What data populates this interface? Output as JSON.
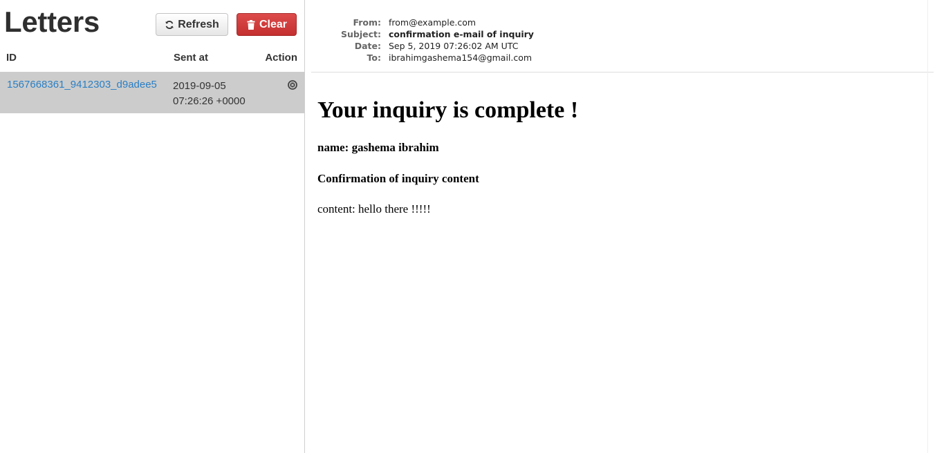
{
  "app": {
    "title": "Letters"
  },
  "toolbar": {
    "refresh_label": "Refresh",
    "clear_label": "Clear"
  },
  "table": {
    "headers": {
      "id": "ID",
      "sent_at": "Sent at",
      "action": "Action"
    },
    "rows": [
      {
        "id": "1567668361_9412303_d9adee5",
        "sent_date": "2019-09-05",
        "sent_time": "07:26:26 +0000",
        "action_icon": "remove-circle-icon"
      }
    ]
  },
  "message": {
    "headers": {
      "from_label": "From:",
      "from": "from@example.com",
      "subject_label": "Subject:",
      "subject": "confirmation e-mail of inquiry",
      "date_label": "Date:",
      "date": "Sep 5, 2019 07:26:02 AM UTC",
      "to_label": "To:",
      "to": "ibrahimgashema154@gmail.com"
    },
    "body": {
      "heading": "Your inquiry is complete !",
      "name_line": "name: gashema ibrahim",
      "section_title": "Confirmation of inquiry content",
      "content_line": "content: hello there !!!!!"
    }
  },
  "colors": {
    "link": "#2a7fc4",
    "danger": "#d33b3b",
    "selected_row": "#cccccc"
  }
}
